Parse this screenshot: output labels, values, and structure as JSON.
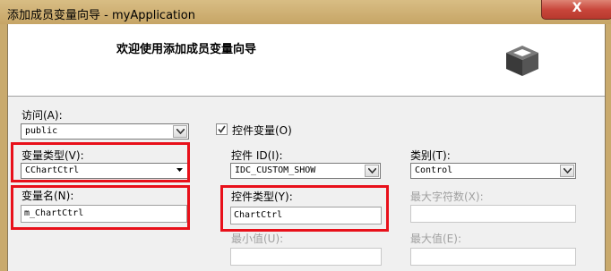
{
  "window": {
    "title": "添加成员变量向导 - myApplication",
    "close_glyph": "X"
  },
  "header": {
    "title": "欢迎使用添加成员变量向导",
    "icon": "wizard-box-icon"
  },
  "access": {
    "label": "访问(A):",
    "value": "public"
  },
  "var_type": {
    "label": "变量类型(V):",
    "value": "CChartCtrl"
  },
  "var_name": {
    "label": "变量名(N):",
    "value": "m_ChartCtrl"
  },
  "control_var": {
    "label": "控件变量(O)",
    "checked": true
  },
  "control_id": {
    "label": "控件 ID(I):",
    "value": "IDC_CUSTOM_SHOW"
  },
  "category": {
    "label": "类别(T):",
    "value": "Control"
  },
  "control_type": {
    "label": "控件类型(Y):",
    "value": "ChartCtrl"
  },
  "max_chars": {
    "label": "最大字符数(X):",
    "value": ""
  },
  "min_value": {
    "label": "最小值(U):",
    "value": ""
  },
  "max_value": {
    "label": "最大值(E):",
    "value": ""
  },
  "colors": {
    "highlight": "#e8101a",
    "frame": "#c9aa6d"
  }
}
